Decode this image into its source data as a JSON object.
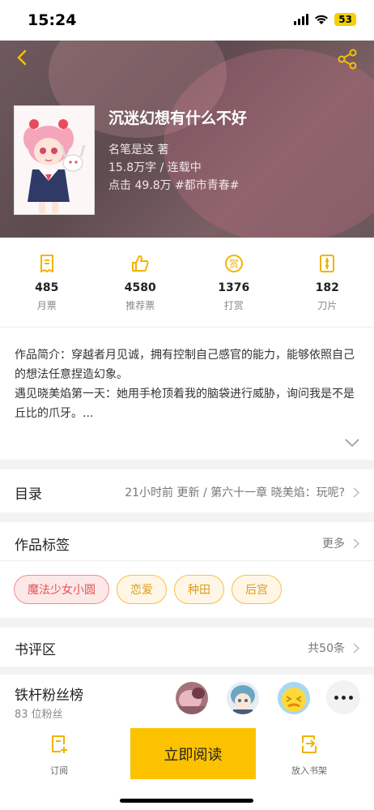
{
  "status_bar": {
    "time": "15:24",
    "battery": "53"
  },
  "book": {
    "title": "沉迷幻想有什么不好",
    "author": "名笔是这 著",
    "words_status": "15.8万字 / 连载中",
    "clicks_category": "点击 49.8万  #都市青春#"
  },
  "stats": [
    {
      "value": "485",
      "label": "月票",
      "icon": "monthly-ticket-icon"
    },
    {
      "value": "4580",
      "label": "推荐票",
      "icon": "thumbs-up-icon"
    },
    {
      "value": "1376",
      "label": "打赏",
      "icon": "reward-icon"
    },
    {
      "value": "182",
      "label": "刀片",
      "icon": "blade-icon"
    }
  ],
  "intro": {
    "line1": "作品简介：穿越者月见诚，拥有控制自己感官的能力，能够依照自己的想法任意捏造幻象。",
    "line2": "遇见晓美焰第一天：她用手枪顶着我的脑袋进行威胁，询问我是不是丘比的爪牙。..."
  },
  "catalog": {
    "title": "目录",
    "latest": "21小时前 更新 / 第六十一章 晓美焰：玩呢?"
  },
  "tags_section": {
    "title": "作品标签",
    "more": "更多",
    "tags": [
      "魔法少女小圆",
      "恋爱",
      "种田",
      "后宫"
    ]
  },
  "reviews": {
    "title": "书评区",
    "count": "共50条"
  },
  "fans": {
    "title": "铁杆粉丝榜",
    "count": "83 位粉丝"
  },
  "bottom_bar": {
    "subscribe": "订阅",
    "read_now": "立即阅读",
    "add_shelf": "放入书架"
  },
  "colors": {
    "accent": "#fcc200",
    "icon_yellow": "#f0b400",
    "tag_red": "#e35353",
    "tag_yellow": "#e19a14"
  }
}
